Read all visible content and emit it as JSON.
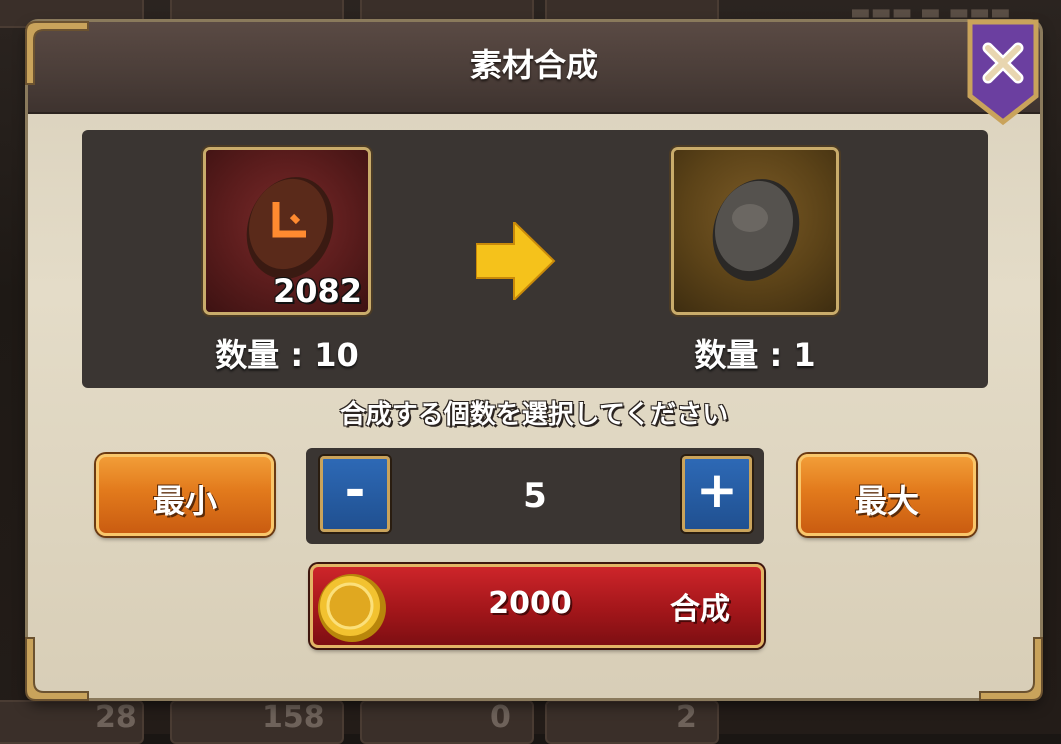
{
  "dialog": {
    "title": "素材合成",
    "close_icon": "close-x-icon"
  },
  "source_item": {
    "icon": "red-rune-stone-icon",
    "owned_count": "2082",
    "quantity_label": "数量 : 10"
  },
  "arrow_icon": "arrow-right-icon",
  "result_item": {
    "icon": "gray-stone-icon",
    "quantity_label": "数量 : 1"
  },
  "instruction": "合成する個数を選択してください",
  "controls": {
    "min_label": "最小",
    "max_label": "最大",
    "minus_label": "-",
    "plus_label": "+",
    "value": "5"
  },
  "craft": {
    "coin_icon": "gold-coin-icon",
    "cost": "2000",
    "label": "合成"
  },
  "background": {
    "numbers": [
      "28",
      "158",
      "0",
      "2"
    ]
  },
  "colors": {
    "header": "#4a3d38",
    "panel": "#3a3532",
    "orange_button": "#e27a1c",
    "blue_button": "#1f4f8f",
    "red_button": "#a3161a",
    "arrow": "#f5c21b",
    "close_badge": "#6b3fa0"
  }
}
